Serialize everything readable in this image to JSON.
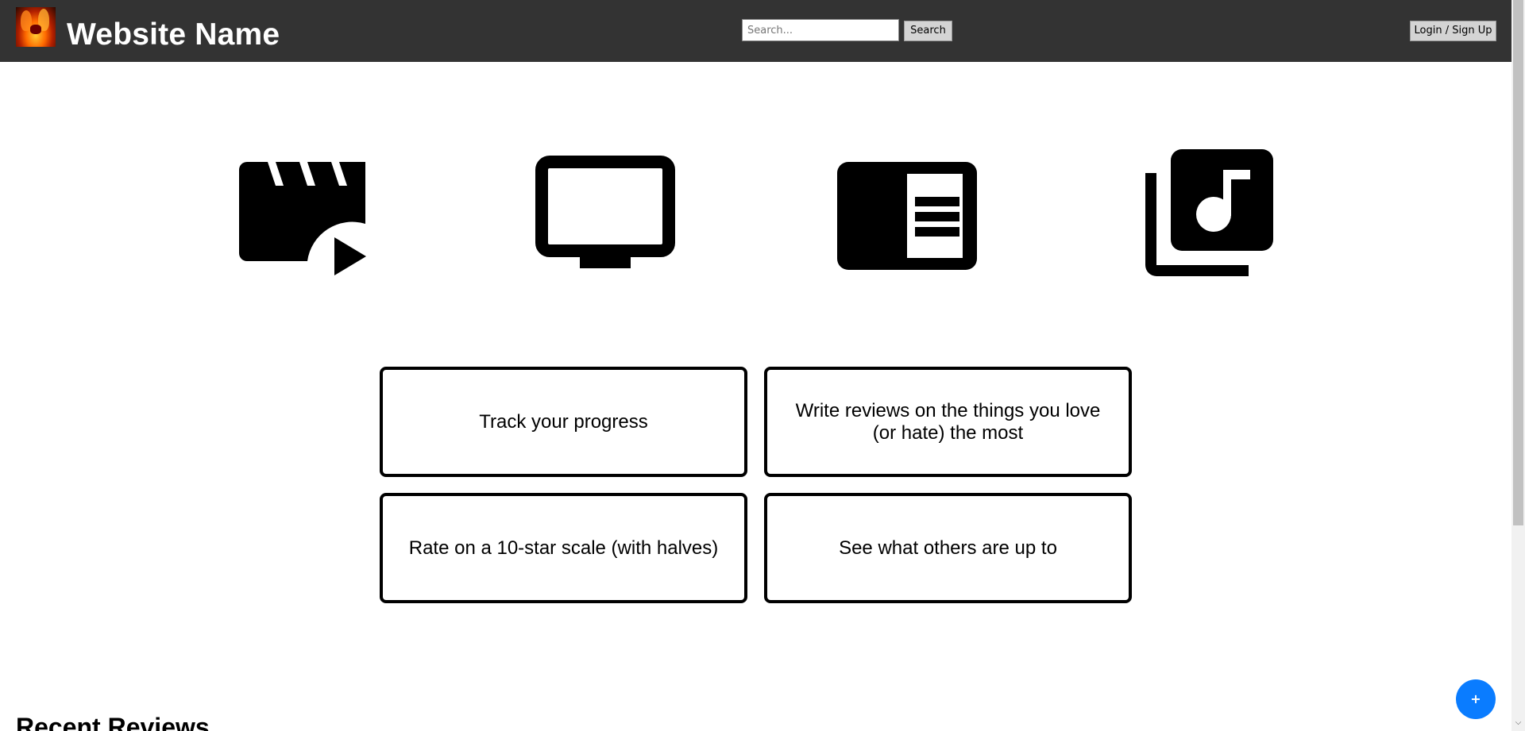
{
  "header": {
    "site_name": "Website Name",
    "logo_icon": "flame-logo-icon",
    "search": {
      "placeholder": "Search...",
      "value": "",
      "button_label": "Search"
    },
    "login_label": "Login / Sign Up",
    "background_color": "#333333"
  },
  "media_icons": [
    {
      "name": "movie-clapper-icon",
      "label": ""
    },
    {
      "name": "tv-icon",
      "label": ""
    },
    {
      "name": "book-icon",
      "label": ""
    },
    {
      "name": "music-library-icon",
      "label": ""
    }
  ],
  "features": [
    {
      "label": "Track your progress"
    },
    {
      "label": "Write reviews on the things you love (or hate) the most"
    },
    {
      "label": "Rate on a 10-star scale (with halves)"
    },
    {
      "label": "See what others are up to"
    }
  ],
  "recent_reviews": {
    "heading": "Recent Reviews"
  },
  "fab": {
    "label": "+",
    "color": "#0a7cff"
  }
}
